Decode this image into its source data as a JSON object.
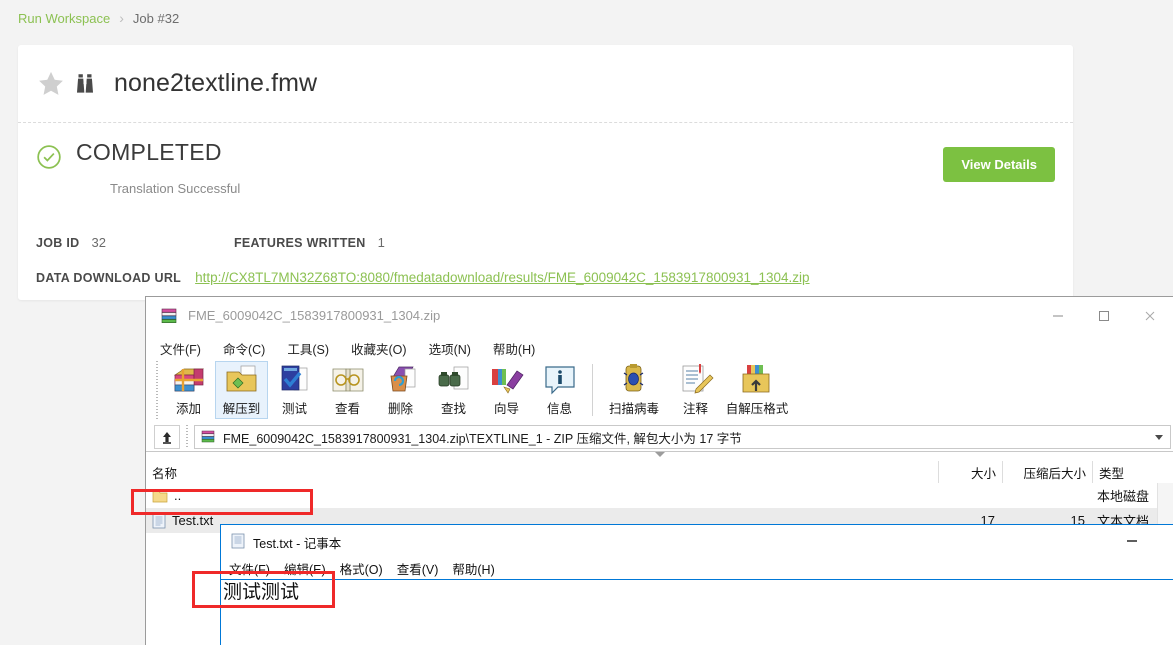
{
  "breadcrumb": {
    "home": "Run Workspace",
    "separator": "›",
    "current": "Job #32"
  },
  "workspace": {
    "title": "none2textline.fmw",
    "star_icon": "star-icon",
    "binoculars_icon": "binoculars-icon"
  },
  "status": {
    "icon": "check-circle-icon",
    "label": "COMPLETED",
    "sub": "Translation Successful",
    "color": "#7cc141"
  },
  "actions": {
    "view_details": "View Details"
  },
  "details": {
    "job_id_label": "JOB ID",
    "job_id_value": "32",
    "features_written_label": "FEATURES WRITTEN",
    "features_written_value": "1",
    "url_label": "DATA DOWNLOAD URL",
    "url_value": "http://CX8TL7MN32Z68TO:8080/fmedatadownload/results/FME_6009042C_1583917800931_1304.zip"
  },
  "winrar": {
    "title": "FME_6009042C_1583917800931_1304.zip",
    "window_buttons": {
      "minimize": "—",
      "maximize": "□",
      "close": "✕"
    },
    "menu": [
      {
        "label": "文件(F)"
      },
      {
        "label": "命令(C)"
      },
      {
        "label": "工具(S)"
      },
      {
        "label": "收藏夹(O)"
      },
      {
        "label": "选项(N)"
      },
      {
        "label": "帮助(H)"
      }
    ],
    "toolbar": [
      {
        "label": "添加",
        "icon": "add-archive-icon",
        "selected": false
      },
      {
        "label": "解压到",
        "icon": "extract-to-icon",
        "selected": true
      },
      {
        "label": "测试",
        "icon": "test-archive-icon",
        "selected": false
      },
      {
        "label": "查看",
        "icon": "view-file-icon",
        "selected": false
      },
      {
        "label": "删除",
        "icon": "delete-icon",
        "selected": false
      },
      {
        "label": "查找",
        "icon": "find-icon",
        "selected": false
      },
      {
        "label": "向导",
        "icon": "wizard-icon",
        "selected": false
      },
      {
        "label": "信息",
        "icon": "info-icon",
        "selected": false
      },
      {
        "label": "扫描病毒",
        "icon": "virus-scan-icon",
        "selected": false
      },
      {
        "label": "注释",
        "icon": "comment-icon",
        "selected": false
      },
      {
        "label": "自解压格式",
        "icon": "sfx-icon",
        "selected": false
      }
    ],
    "address": "FME_6009042C_1583917800931_1304.zip\\TEXTLINE_1 - ZIP 压缩文件, 解包大小为 17 字节",
    "up_button_icon": "up-one-level-icon",
    "columns": {
      "name": "名称",
      "size": "大小",
      "packed": "压缩后大小",
      "type": "类型"
    },
    "rows": [
      {
        "name": "..",
        "size": "",
        "packed": "",
        "type": "本地磁盘",
        "icon": "folder-up-icon",
        "selected": false
      },
      {
        "name": "Test.txt",
        "size": "17",
        "packed": "15",
        "type": "文本文档",
        "icon": "text-file-icon",
        "selected": true
      }
    ]
  },
  "notepad": {
    "title": "Test.txt - 记事本",
    "icon": "notepad-icon",
    "minimize": "—",
    "menu": [
      {
        "label": "文件(F)"
      },
      {
        "label": "编辑(E)"
      },
      {
        "label": "格式(O)"
      },
      {
        "label": "查看(V)"
      },
      {
        "label": "帮助(H)"
      }
    ],
    "content": "测试测试"
  },
  "annotations": {
    "file_row_highlight": "Test.txt row highlighted",
    "notepad_text_highlight": "Notepad content highlighted",
    "color": "#ef2929"
  }
}
